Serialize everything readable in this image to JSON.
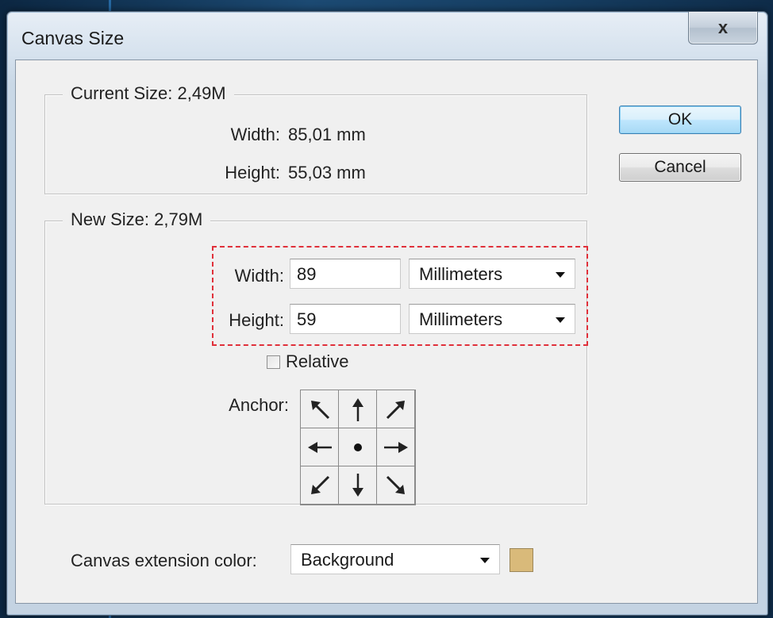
{
  "window": {
    "title": "Canvas Size",
    "close_glyph": "x"
  },
  "current_size": {
    "title": "Current Size: 2,49M",
    "width_label": "Width:",
    "width_value": "85,01 mm",
    "height_label": "Height:",
    "height_value": "55,03 mm"
  },
  "new_size": {
    "title": "New Size: 2,79M",
    "width_label": "Width:",
    "width_value": "89",
    "width_unit": "Millimeters",
    "height_label": "Height:",
    "height_value": "59",
    "height_unit": "Millimeters",
    "relative_label": "Relative",
    "relative_checked": false,
    "anchor_label": "Anchor:",
    "anchor_cells": [
      "arrow-up-left-icon",
      "arrow-up-icon",
      "arrow-up-right-icon",
      "arrow-left-icon",
      "anchor-center-dot-icon",
      "arrow-right-icon",
      "arrow-down-left-icon",
      "arrow-down-icon",
      "arrow-down-right-icon"
    ]
  },
  "buttons": {
    "ok": "OK",
    "cancel": "Cancel"
  },
  "extension": {
    "label": "Canvas extension color:",
    "value": "Background",
    "swatch_color": "#d9ba7a"
  },
  "colors": {
    "highlight": "#e0303a",
    "default_button": "#bee6fd"
  }
}
